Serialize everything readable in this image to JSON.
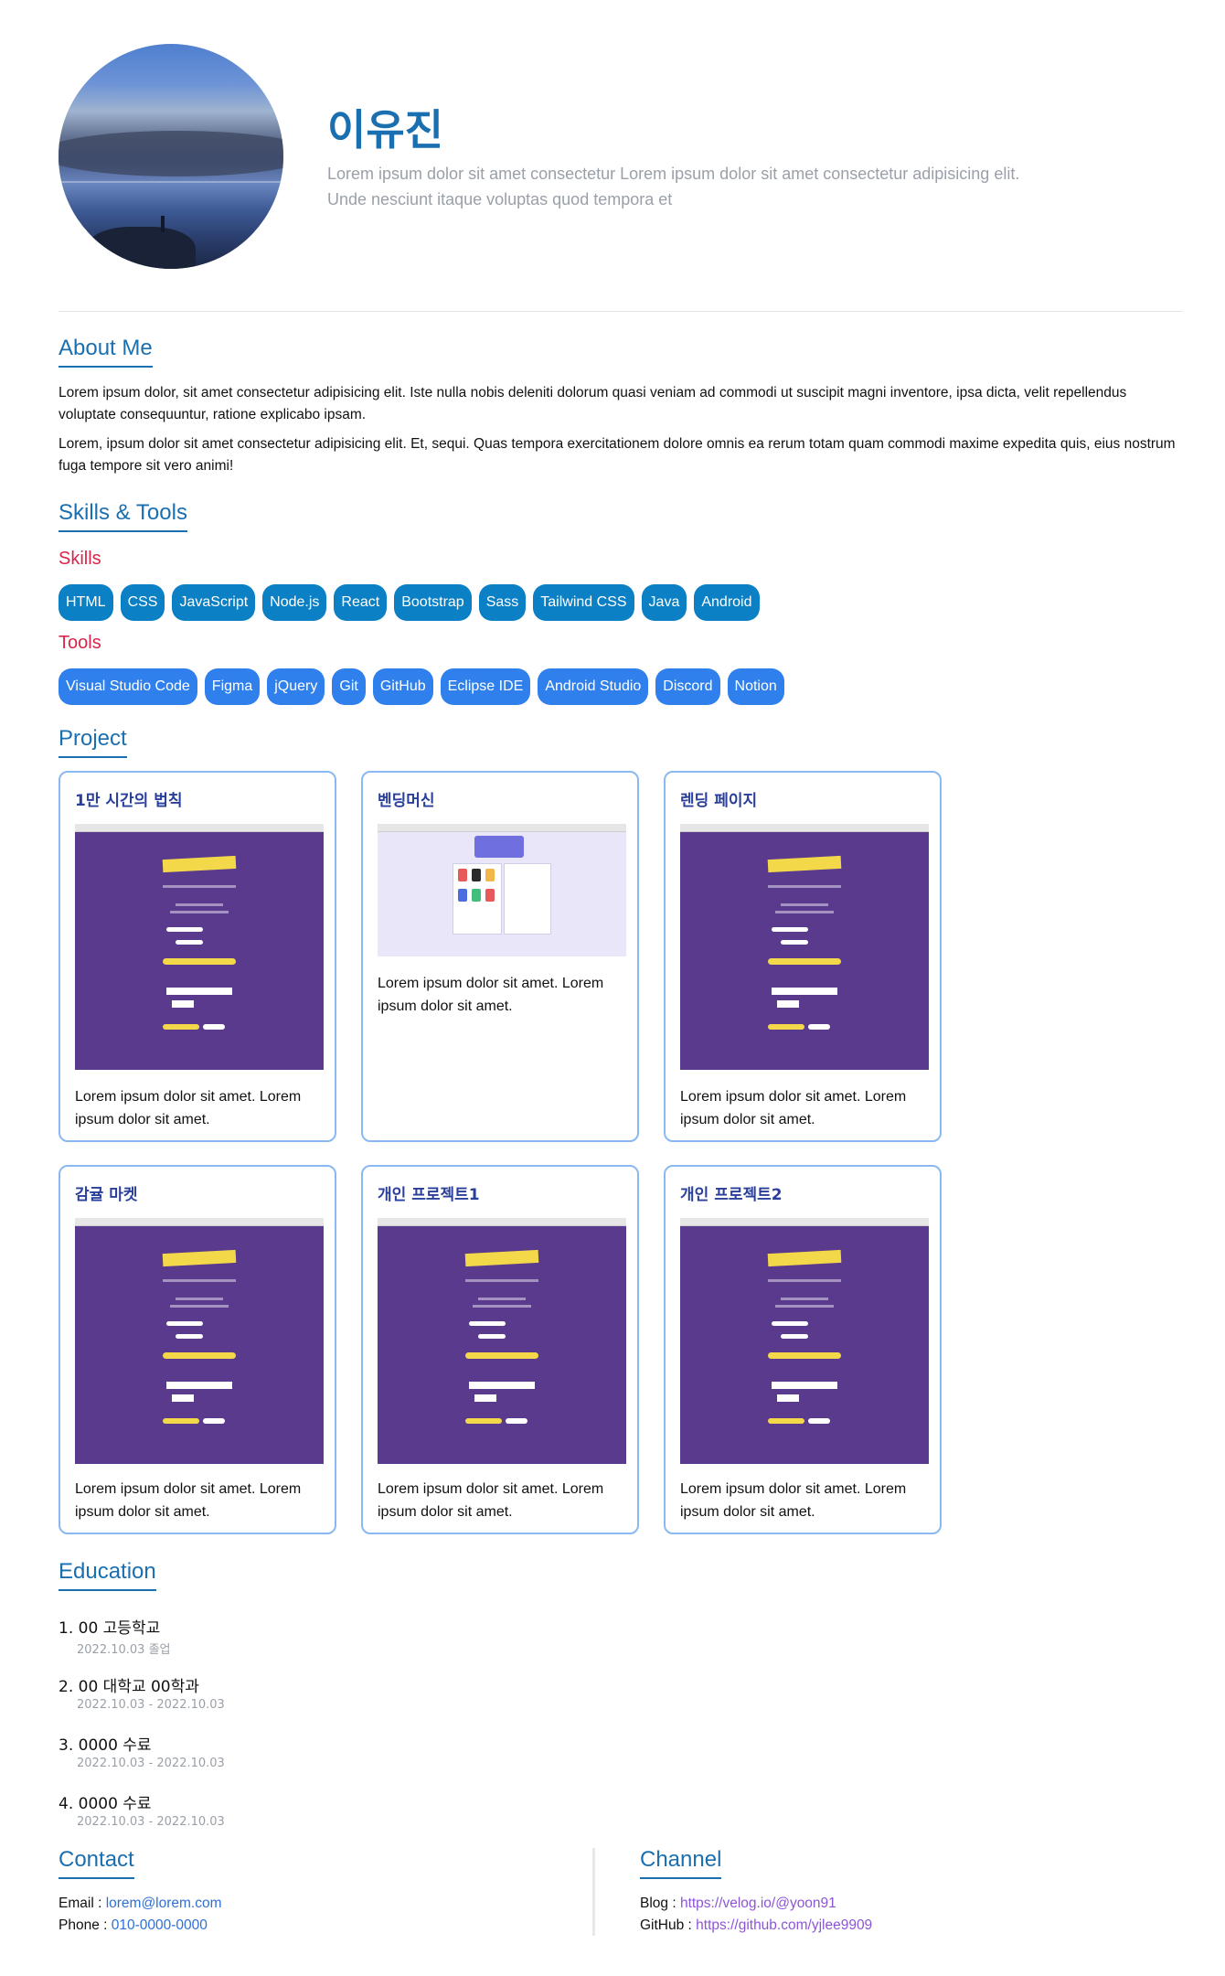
{
  "profile": {
    "name": "이유진",
    "intro": "Lorem ipsum dolor sit amet consectetur Lorem ipsum dolor sit amet consectetur adipisicing elit. Unde nesciunt itaque voluptas quod tempora et"
  },
  "about": {
    "title": "About Me",
    "paragraphs": [
      "Lorem ipsum dolor, sit amet consectetur adipisicing elit. Iste nulla nobis deleniti dolorum quasi veniam ad commodi ut suscipit magni inventore, ipsa dicta, velit repellendus voluptate consequuntur, ratione explicabo ipsam.",
      "Lorem, ipsum dolor sit amet consectetur adipisicing elit. Et, sequi. Quas tempora exercitationem dolore omnis ea rerum totam quam commodi maxime expedita quis, eius nostrum fuga tempore sit vero animi!"
    ]
  },
  "skills_tools": {
    "title": "Skills & Tools",
    "skills_label": "Skills",
    "skills": [
      "HTML",
      "CSS",
      "JavaScript",
      "Node.js",
      "React",
      "Bootstrap",
      "Sass",
      "Tailwind CSS",
      "Java",
      "Android"
    ],
    "tools_label": "Tools",
    "tools": [
      "Visual Studio Code",
      "Figma",
      "jQuery",
      "Git",
      "GitHub",
      "Eclipse IDE",
      "Android Studio",
      "Discord",
      "Notion"
    ],
    "colors": {
      "skill_chip": "#0b80c5",
      "tool_chip": "#2f80ed",
      "sub_title": "#d6264a"
    }
  },
  "project": {
    "title": "Project",
    "cards": [
      {
        "title": "1만 시간의 법칙",
        "desc": "Lorem ipsum dolor sit amet. Lorem ipsum dolor sit amet.",
        "thumb": "purple"
      },
      {
        "title": "벤딩머신",
        "desc": "Lorem ipsum dolor sit amet. Lorem ipsum dolor sit amet.",
        "thumb": "light"
      },
      {
        "title": "렌딩 페이지",
        "desc": "Lorem ipsum dolor sit amet. Lorem ipsum dolor sit amet.",
        "thumb": "purple"
      },
      {
        "title": "감귤 마켓",
        "desc": "Lorem ipsum dolor sit amet. Lorem ipsum dolor sit amet.",
        "thumb": "purple"
      },
      {
        "title": "개인 프로젝트1",
        "desc": "Lorem ipsum dolor sit amet. Lorem ipsum dolor sit amet.",
        "thumb": "purple"
      },
      {
        "title": "개인 프로젝트2",
        "desc": "Lorem ipsum dolor sit amet. Lorem ipsum dolor sit amet.",
        "thumb": "purple"
      }
    ]
  },
  "education": {
    "title": "Education",
    "items": [
      {
        "label": "1. 00 고등학교",
        "date": "2022.10.03 졸업"
      },
      {
        "label": "2. 00 대학교 00학과",
        "date": "2022.10.03 - 2022.10.03"
      },
      {
        "label": "3. 0000 수료",
        "date": "2022.10.03 - 2022.10.03"
      },
      {
        "label": "4. 0000 수료",
        "date": "2022.10.03 - 2022.10.03"
      }
    ]
  },
  "contact": {
    "title": "Contact",
    "email_label": "Email : ",
    "email": "lorem@lorem.com",
    "phone_label": "Phone : ",
    "phone": "010-0000-0000"
  },
  "channel": {
    "title": "Channel",
    "blog_label": "Blog : ",
    "blog": "https://velog.io/@yoon91",
    "github_label": "GitHub : ",
    "github": "https://github.com/yjlee9909"
  },
  "theme": {
    "accent": "#1a6fb0",
    "card_border": "#8ab8f2",
    "muted": "#9aa0a8"
  }
}
